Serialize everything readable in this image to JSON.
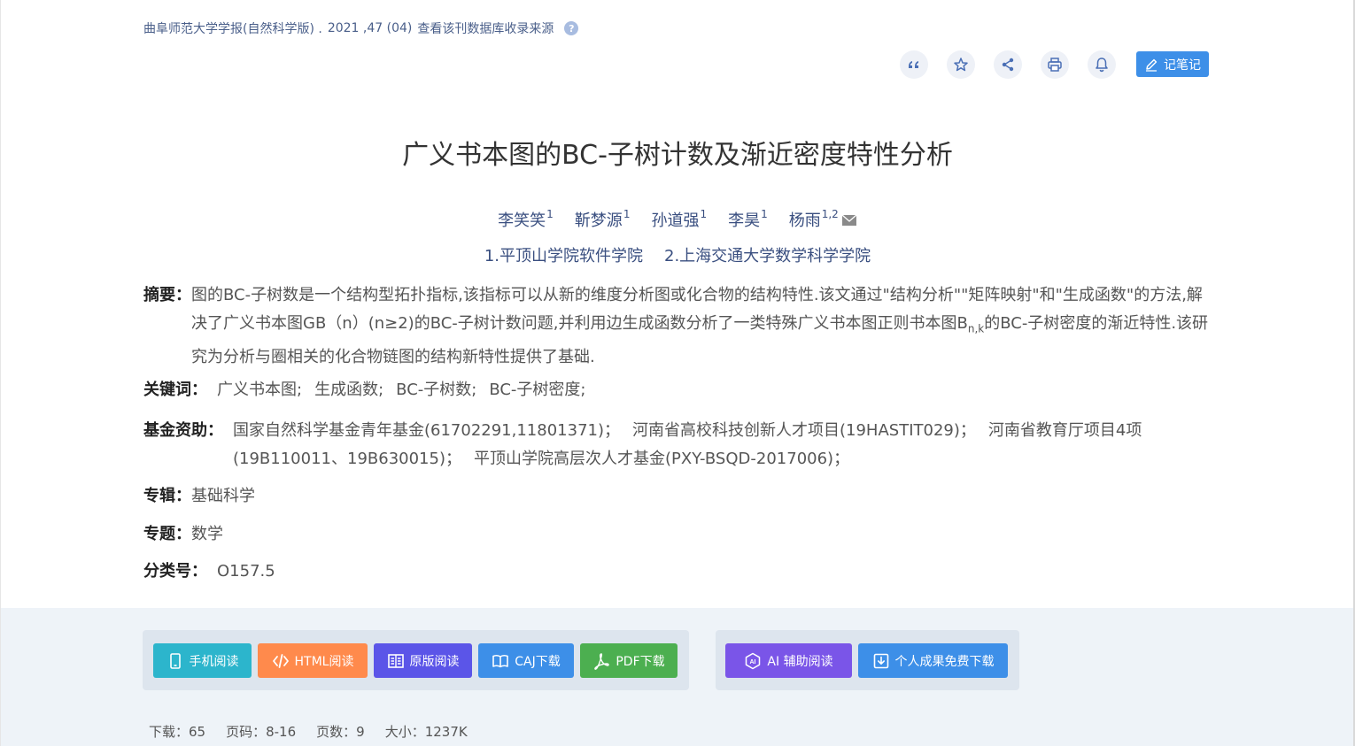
{
  "source": {
    "journal": "曲阜师范大学学报(自然科学版) .",
    "issue": "2021 ,47 (04)",
    "db_link": "查看该刊数据库收录来源",
    "help": "?"
  },
  "toolbar": {
    "icons": [
      "quote-icon",
      "star-icon",
      "share-icon",
      "print-icon",
      "bell-icon"
    ],
    "note_label": "记笔记"
  },
  "title": "广义书本图的BC-子树计数及渐近密度特性分析",
  "authors": [
    {
      "name": "李笑笑",
      "sup": "1"
    },
    {
      "name": "靳梦源",
      "sup": "1"
    },
    {
      "name": "孙道强",
      "sup": "1"
    },
    {
      "name": "李昊",
      "sup": "1"
    },
    {
      "name": "杨雨",
      "sup": "1,2"
    }
  ],
  "orgs": [
    "1.平顶山学院软件学院",
    "2.上海交通大学数学科学学院"
  ],
  "abstract": {
    "label": "摘要：",
    "part1": "图的BC-子树数是一个结构型拓扑指标,该指标可以从新的维度分析图或化合物的结构特性.该文通过\"结构分析\"\"矩阵映射\"和\"生成函数\"的方法,解决了广义书本图GB（n）(n≥2)的BC-子树计数问题,并利用边生成函数分析了一类特殊广义书本图正则书本图B",
    "sub": "n,k",
    "part2": "的BC-子树密度的渐近特性.该研究为分析与圈相关的化合物链图的结构新特性提供了基础."
  },
  "keywords": {
    "label": "关键词：",
    "items": [
      "广义书本图;",
      "生成函数;",
      "BC-子树数;",
      "BC-子树密度;"
    ]
  },
  "funding": {
    "label": "基金资助：",
    "items": [
      "国家自然科学基金青年基金(61702291,11801371)；",
      "河南省高校科技创新人才项目(19HASTIT029)；",
      "河南省教育厅项目4项(19B110011、19B630015)；",
      "平顶山学院高层次人才基金(PXY-BSQD-2017006)；"
    ]
  },
  "series": {
    "label": "专辑：",
    "value": "基础科学"
  },
  "subject": {
    "label": "专题：",
    "value": "数学"
  },
  "classification": {
    "label": "分类号：",
    "value": "O157.5"
  },
  "downloads": {
    "mobile": "手机阅读",
    "html": "HTML阅读",
    "original": "原版阅读",
    "caj": "CAJ下载",
    "pdf": "PDF下载",
    "ai": "AI 辅助阅读",
    "personal": "个人成果免费下载"
  },
  "colors": {
    "mobile": "#2cb5cc",
    "html": "#ff8a4c",
    "original": "#5b55e8",
    "caj": "#3d8fe8",
    "pdf": "#4caf50",
    "ai": "#7a55e8",
    "personal": "#3d8fe8",
    "accent": "#3d8fe8"
  },
  "stats": {
    "downloads": "下载：65",
    "pages_range": "页码：8-16",
    "page_count": "页数：9",
    "size": "大小：1237K"
  }
}
